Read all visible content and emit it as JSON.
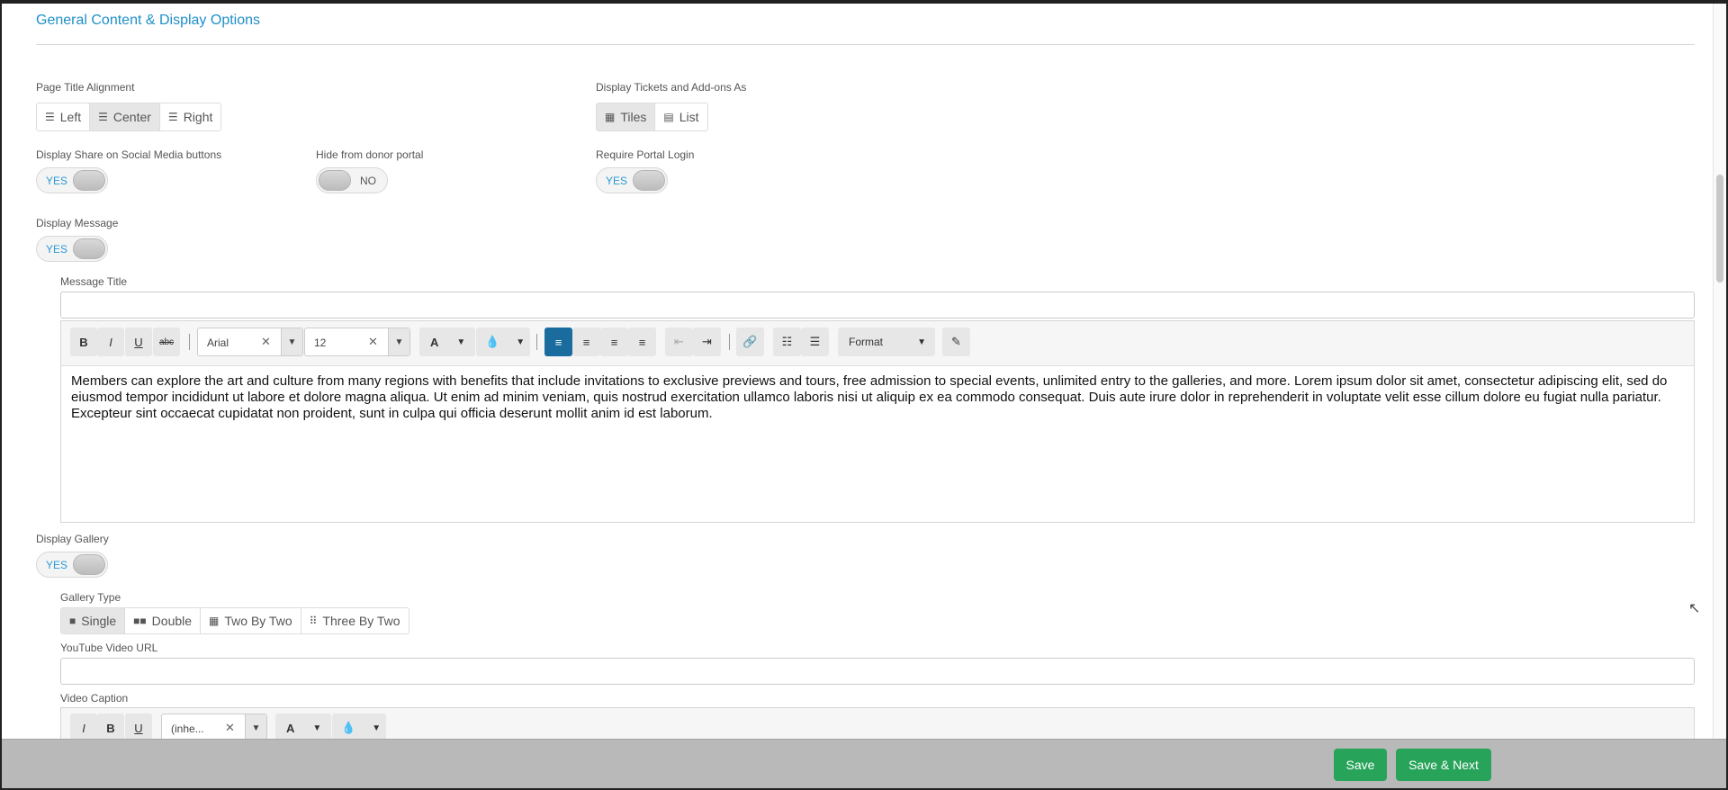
{
  "section_title": "General Content & Display Options",
  "page_title_alignment": {
    "label": "Page Title Alignment",
    "options": [
      "Left",
      "Center",
      "Right"
    ],
    "selected": "Center"
  },
  "display_tickets": {
    "label": "Display Tickets and Add-ons As",
    "options": [
      "Tiles",
      "List"
    ],
    "selected": "Tiles"
  },
  "share_social": {
    "label": "Display Share on Social Media buttons",
    "state": "YES"
  },
  "hide_donor": {
    "label": "Hide from donor portal",
    "state": "NO"
  },
  "require_login": {
    "label": "Require Portal Login",
    "state": "YES"
  },
  "display_message": {
    "label": "Display Message",
    "state": "YES"
  },
  "message_title": {
    "label": "Message Title",
    "value": ""
  },
  "editor": {
    "bold": "B",
    "italic": "I",
    "underline": "U",
    "strike": "abc",
    "font": "Arial",
    "size": "12",
    "color_letter": "A",
    "format": "Format",
    "content": "Members can explore the art and culture from many regions with benefits that include invitations to exclusive previews and tours, free admission to special events, unlimited entry to the galleries, and more. Lorem ipsum dolor sit amet, consectetur adipiscing elit, sed do eiusmod tempor incididunt ut labore et dolore magna aliqua. Ut enim ad minim veniam, quis nostrud exercitation ullamco laboris nisi ut aliquip ex ea commodo consequat. Duis aute irure dolor in reprehenderit in voluptate velit esse cillum dolore eu fugiat nulla pariatur. Excepteur sint occaecat cupidatat non proident, sunt in culpa qui officia deserunt mollit anim id est laborum."
  },
  "display_gallery": {
    "label": "Display Gallery",
    "state": "YES"
  },
  "gallery_type": {
    "label": "Gallery Type",
    "options": [
      "Single",
      "Double",
      "Two By Two",
      "Three By Two"
    ],
    "selected": "Single"
  },
  "youtube_url": {
    "label": "YouTube Video URL",
    "value": ""
  },
  "video_caption": {
    "label": "Video Caption",
    "italic": "I",
    "bold": "B",
    "underline": "U",
    "font": "(inhe...",
    "color_letter": "A"
  },
  "footer": {
    "save": "Save",
    "save_next": "Save & Next"
  },
  "colors": {
    "accent": "#1f8fc8",
    "toggle_yes": "#2a9ad6",
    "green": "#28a35a",
    "active_align": "#1a6c9e"
  }
}
